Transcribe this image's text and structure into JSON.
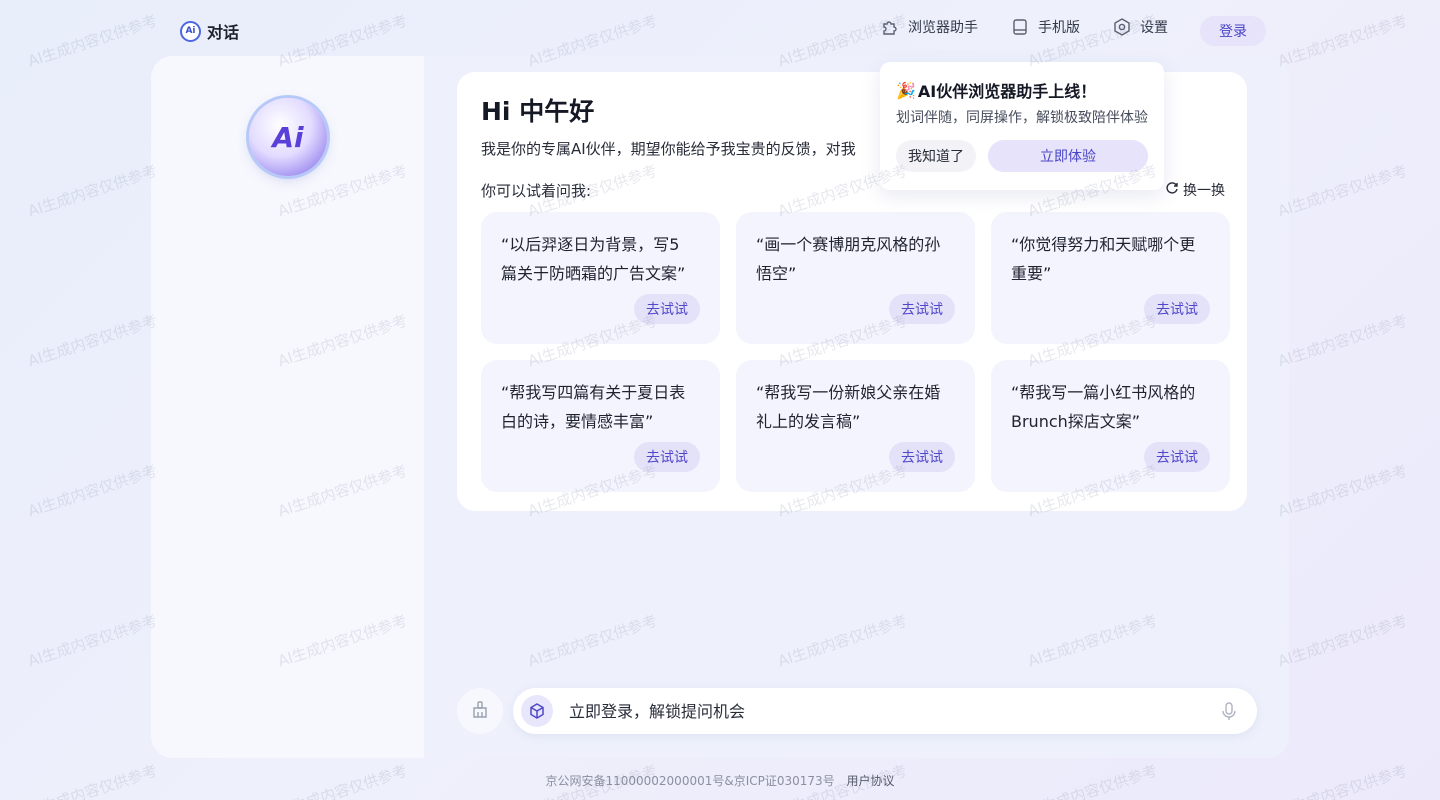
{
  "header": {
    "logo_text": "对话",
    "logo_mark": "Ai",
    "nav": [
      {
        "label": "浏览器助手",
        "icon": "puzzle-icon"
      },
      {
        "label": "手机版",
        "icon": "mobile-icon"
      },
      {
        "label": "设置",
        "icon": "gear-icon"
      }
    ],
    "login_label": "登录"
  },
  "sidebar": {
    "avatar_text": "Ai"
  },
  "welcome": {
    "greeting": "Hi 中午好",
    "intro": "我是你的专属AI伙伴，期望你能给予我宝贵的反馈，对我",
    "try_label": "你可以试着问我:",
    "refresh_label": "换一换",
    "suggestions": [
      {
        "text": "“以后羿逐日为背景，写5篇关于防晒霜的广告文案”",
        "button": "去试试"
      },
      {
        "text": "“画一个赛博朋克风格的孙悟空”",
        "button": "去试试"
      },
      {
        "text": "“你觉得努力和天赋哪个更重要”",
        "button": "去试试"
      },
      {
        "text": "“帮我写四篇有关于夏日表白的诗，要情感丰富”",
        "button": "去试试"
      },
      {
        "text": "“帮我写一份新娘父亲在婚礼上的发言稿”",
        "button": "去试试"
      },
      {
        "text": "“帮我写一篇小红书风格的Brunch探店文案”",
        "button": "去试试"
      }
    ]
  },
  "popup": {
    "emoji": "🎉",
    "title": "AI伙伴浏览器助手上线！",
    "description": "划词伴随，同屏操作，解锁极致陪伴体验",
    "dismiss_label": "我知道了",
    "try_label": "立即体验"
  },
  "input": {
    "placeholder": "立即登录，解锁提问机会"
  },
  "footer": {
    "icp": "京公网安备11000002000001号&京ICP证030173号",
    "agreement": "用户协议"
  },
  "watermark": "AI生成内容仅供参考",
  "colors": {
    "accent": "#4a45c6",
    "button_bg": "#e6e3fa",
    "card_bg": "#f3f4fd"
  }
}
